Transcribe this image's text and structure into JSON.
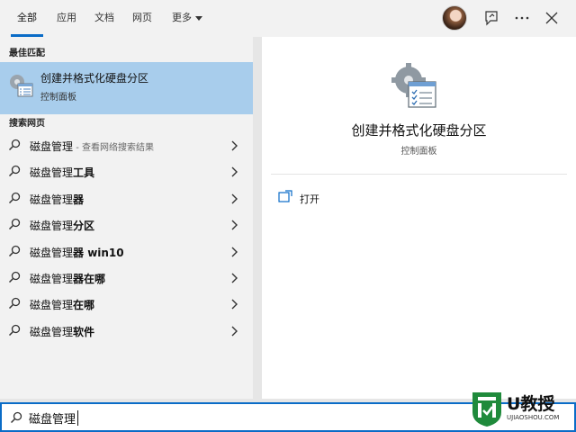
{
  "tabs": [
    {
      "label": "全部",
      "active": true
    },
    {
      "label": "应用"
    },
    {
      "label": "文档"
    },
    {
      "label": "网页"
    },
    {
      "label": "更多"
    }
  ],
  "toolbar": {
    "avatar": "user-avatar",
    "feedback_icon": "feedback-icon",
    "more_icon": "ellipsis-icon",
    "close_icon": "close-icon"
  },
  "best_match": {
    "header": "最佳匹配",
    "title": "创建并格式化硬盘分区",
    "subtitle": "控制面板",
    "icon": "disk-management-icon"
  },
  "web_search": {
    "header": "搜索网页",
    "items": [
      {
        "prefix": "磁盘管理",
        "bold": "",
        "hint": " - 查看网络搜索结果"
      },
      {
        "prefix": "磁盘管理",
        "bold": "工具",
        "hint": ""
      },
      {
        "prefix": "磁盘管理",
        "bold": "器",
        "hint": ""
      },
      {
        "prefix": "磁盘管理",
        "bold": "分区",
        "hint": ""
      },
      {
        "prefix": "磁盘管理",
        "bold": "器 win10",
        "hint": ""
      },
      {
        "prefix": "磁盘管理",
        "bold": "器在哪",
        "hint": ""
      },
      {
        "prefix": "磁盘管理",
        "bold": "在哪",
        "hint": ""
      },
      {
        "prefix": "磁盘管理",
        "bold": "软件",
        "hint": ""
      }
    ]
  },
  "detail": {
    "title": "创建并格式化硬盘分区",
    "subtitle": "控制面板",
    "actions": [
      {
        "label": "打开",
        "icon": "open-window-icon"
      }
    ]
  },
  "search": {
    "value": "磁盘管理"
  },
  "watermark": {
    "brand": "U教授",
    "url": "UJIAOSHOU.COM"
  },
  "colors": {
    "accent": "#0a6cc7",
    "selected_bg": "#a8cdec",
    "panel_bg": "#f2f2f2"
  }
}
